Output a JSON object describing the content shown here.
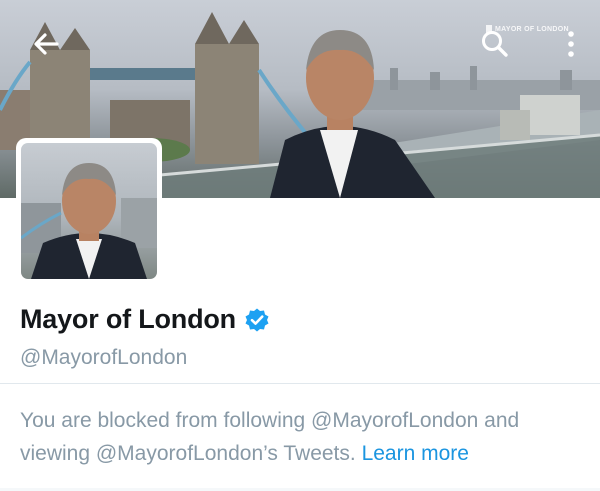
{
  "header": {
    "back_icon": "arrow-left-icon",
    "search_icon": "search-icon",
    "more_icon": "more-vertical-icon",
    "watermark_text": "MAYOR OF LONDON"
  },
  "profile": {
    "name": "Mayor of London",
    "handle": "@MayorofLondon",
    "verified": true,
    "verified_icon": "verified-badge-icon"
  },
  "blocked_notice": {
    "message": "You are blocked from following @MayorofLondon and viewing @MayorofLondon’s Tweets.",
    "link_label": "Learn more"
  },
  "colors": {
    "name_text": "#14171a",
    "secondary_text": "#8899a6",
    "link": "#1b95e0",
    "verified_blue": "#1da1f2",
    "divider": "#e1e8ed"
  }
}
